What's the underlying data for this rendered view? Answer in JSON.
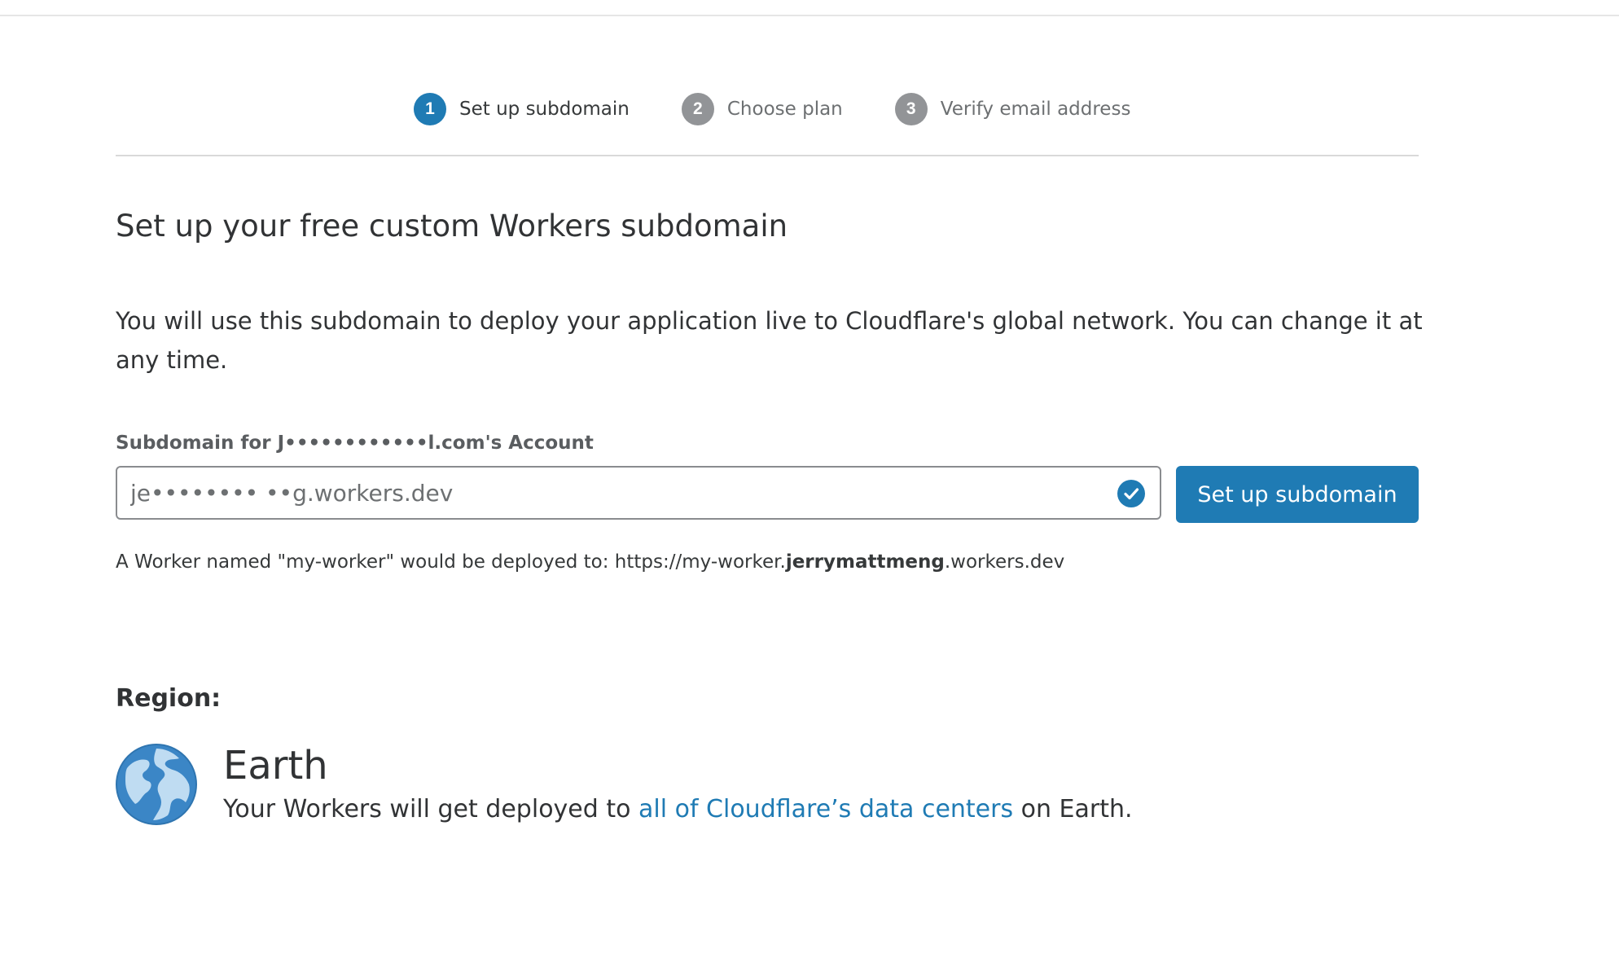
{
  "stepper": {
    "steps": [
      {
        "number": "1",
        "label": "Set up subdomain",
        "active": true
      },
      {
        "number": "2",
        "label": "Choose plan",
        "active": false
      },
      {
        "number": "3",
        "label": "Verify email address",
        "active": false
      }
    ]
  },
  "main": {
    "title": "Set up your free custom Workers subdomain",
    "description": "You will use this subdomain to deploy your application live to Cloudflare's global network. You can change it at any time.",
    "field_label": "Subdomain for J••••••••••••l.com's Account",
    "subdomain_value": "je•••••••• ••g.workers.dev",
    "setup_button_label": "Set up subdomain",
    "hint_prefix": "A Worker named \"my-worker\" would be deployed to: https://my-worker.",
    "hint_subdomain": "jerrymattmeng",
    "hint_suffix": ".workers.dev"
  },
  "region": {
    "label": "Region:",
    "name": "Earth",
    "desc_prefix": "Your Workers will get deployed to ",
    "desc_link": "all of Cloudflare’s data centers",
    "desc_suffix": " on Earth."
  },
  "colors": {
    "accent": "#1f7bb4",
    "inactive_step": "#929497"
  },
  "icons": {
    "valid": "check-circle-icon",
    "region": "globe-icon"
  }
}
